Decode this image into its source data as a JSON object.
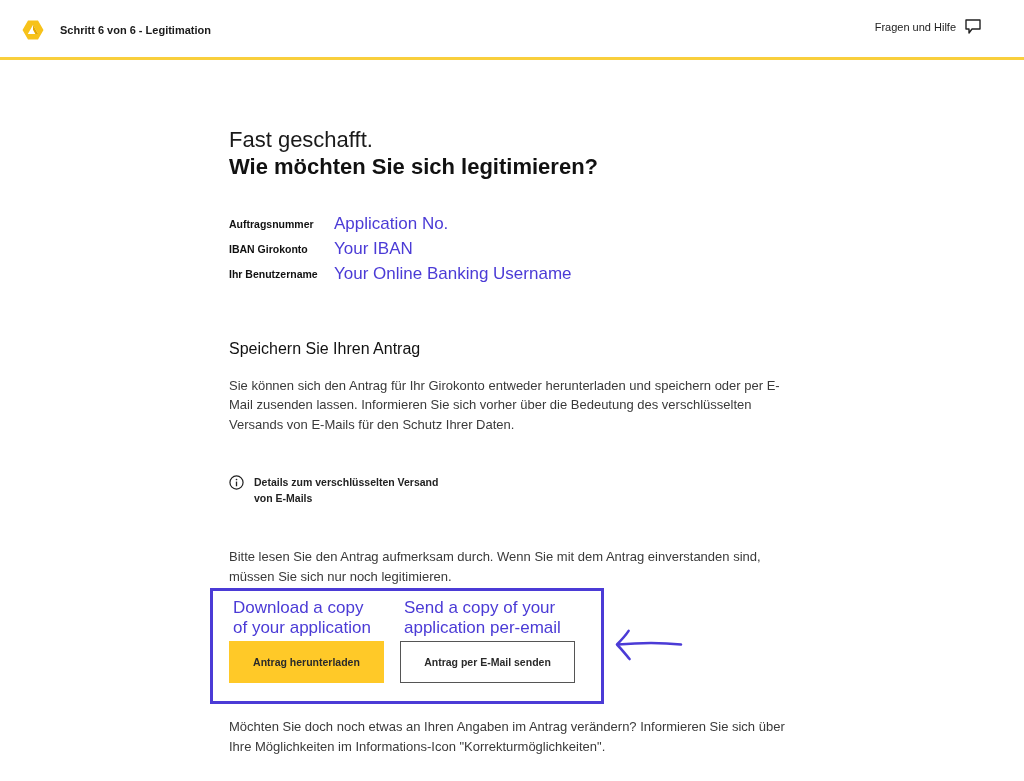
{
  "header": {
    "step": "Schritt 6 von 6 - Legitimation",
    "help_link": "Fragen und Hilfe"
  },
  "heading": {
    "intro": "Fast geschafft.",
    "question": "Wie möchten Sie sich legitimieren?"
  },
  "details": [
    {
      "label": "Auftragsnummer",
      "value": "Application No."
    },
    {
      "label": "IBAN Girokonto",
      "value": "Your IBAN"
    },
    {
      "label": "Ihr Benutzername",
      "value": "Your Online Banking Username"
    }
  ],
  "save_section": {
    "title": "Speichern Sie Ihren Antrag",
    "text": "Sie können sich den Antrag für Ihr Girokonto entweder herunterladen und speichern oder per E-Mail zusenden lassen. Informieren Sie sich vorher über die Bedeutung des verschlüsselten Versands von E-Mails für den Schutz Ihrer Daten.",
    "info_link": "Details zum verschlüsselten Versand von E-Mails"
  },
  "instruction": "Bitte lesen Sie den Antrag aufmerksam durch. Wenn Sie mit dem Antrag einverstanden sind, müssen Sie sich nur noch legitimieren.",
  "actions": [
    {
      "kind": "primary",
      "label": "Antrag herunterladen",
      "annotation": "Download a copy of your application"
    },
    {
      "kind": "secondary",
      "label": "Antrag per E-Mail senden",
      "annotation": "Send a copy of your application per-email"
    }
  ],
  "closing_text": "Möchten Sie doch noch etwas an Ihren Angaben im Antrag verändern? Informieren Sie sich über Ihre Möglichkeiten im Informations-Icon \"Korrekturmöglichkeiten\"."
}
